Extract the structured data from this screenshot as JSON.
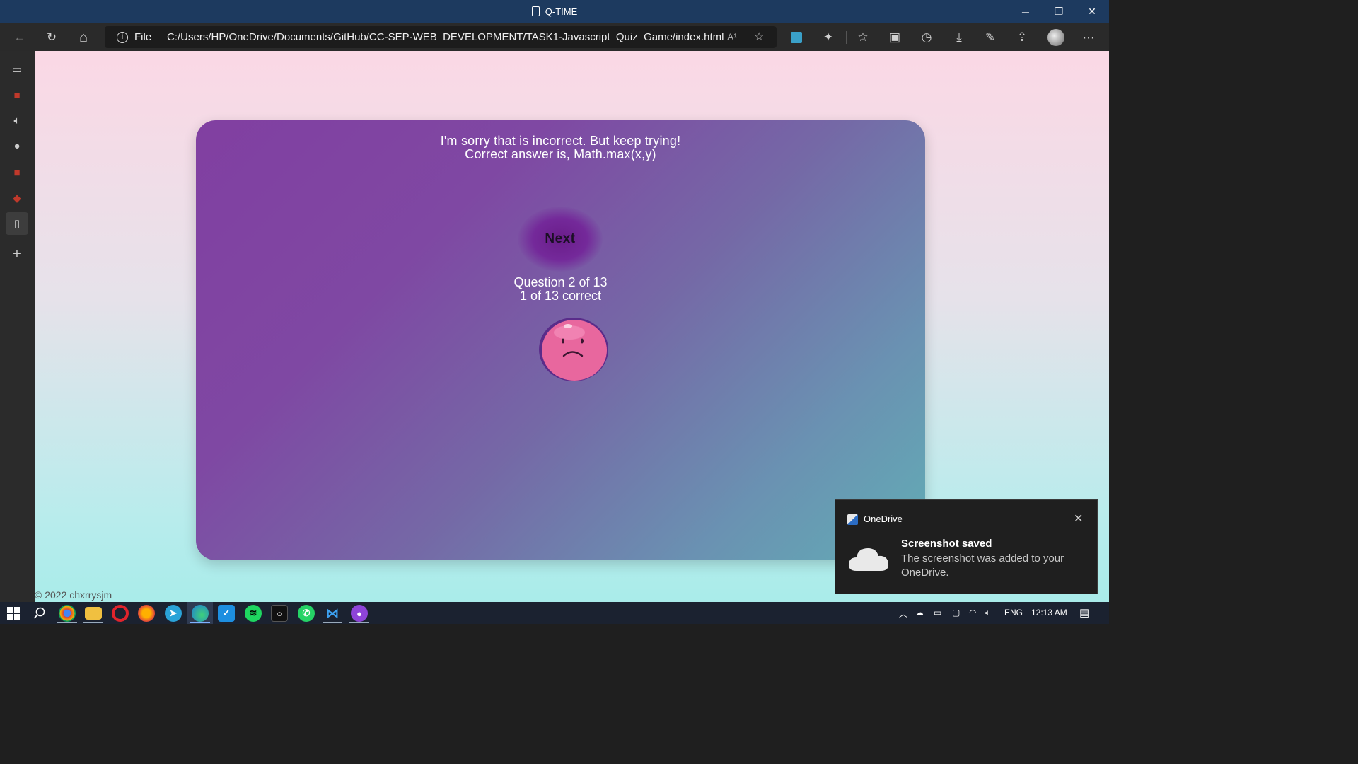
{
  "window": {
    "title": "Q-TIME",
    "minimize": "─",
    "restore": "❐",
    "close": "✕"
  },
  "toolbar": {
    "back_icon": "←",
    "refresh_icon": "↻",
    "home_icon": "⌂",
    "info_icon": "i",
    "file_label": "File",
    "url": "C:/Users/HP/OneDrive/Documents/GitHub/CC-SEP-WEB_DEVELOPMENT/TASK1-Javascript_Quiz_Game/index.html",
    "read_aloud": "A¹",
    "favorite": "☆",
    "more": "···"
  },
  "quiz": {
    "message_line1": "I'm sorry that is incorrect. But keep trying!",
    "message_line2": "Correct answer is, Math.max(x,y)",
    "next_label": "Next",
    "question_progress": "Question 2 of 13",
    "score_progress": "1 of 13 correct"
  },
  "footer": {
    "copyright": "© 2022 chxrrysjm"
  },
  "toast": {
    "app_name": "OneDrive",
    "close": "✕",
    "title": "Screenshot saved",
    "body": "The screenshot was added to your OneDrive."
  },
  "taskbar": {
    "language": "ENG",
    "time": "12:13 AM"
  },
  "colors": {
    "card_start": "#813fa1",
    "card_end": "#62adb5",
    "face_pink": "#e8679e"
  }
}
